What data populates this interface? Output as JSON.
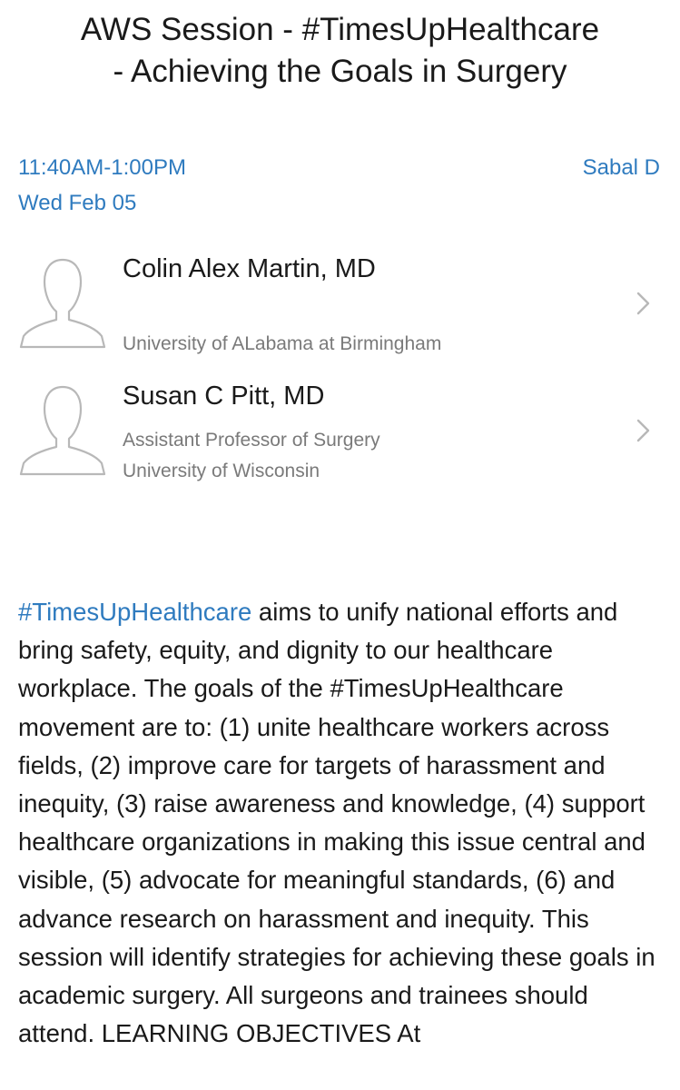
{
  "session": {
    "title_line1": "AWS Session - #TimesUpHealthcare",
    "title_line2": "- Achieving the Goals in Surgery",
    "time": "11:40AM-1:00PM",
    "date": "Wed Feb 05",
    "room": "Sabal D"
  },
  "speakers": [
    {
      "name": "Colin Alex Martin, MD",
      "lines": [
        "University of ALabama at Birmingham"
      ]
    },
    {
      "name": "Susan C Pitt, MD",
      "lines": [
        "Assistant Professor of Surgery",
        "University of Wisconsin"
      ]
    }
  ],
  "description": {
    "hashtag": "#TimesUpHealthcare",
    "text": " aims to unify national efforts and bring safety, equity, and dignity to our healthcare workplace. The goals of the #TimesUpHealthcare movement are to: (1) unite healthcare workers across fields, (2) improve care for targets of harassment and inequity, (3) raise awareness and knowledge, (4) support healthcare organizations in making this issue central and visible, (5) advocate for meaningful standards, (6) and advance research on harassment and inequity. This session will identify strategies for achieving these goals in academic surgery. All surgeons and trainees should attend. LEARNING OBJECTIVES At"
  },
  "icons": {
    "avatar": "person-outline-icon",
    "chevron": "chevron-right-icon"
  },
  "colors": {
    "accent": "#2f7bbf",
    "secondary_text": "#7a7a7a",
    "icon_stroke": "#b8b8b8"
  }
}
